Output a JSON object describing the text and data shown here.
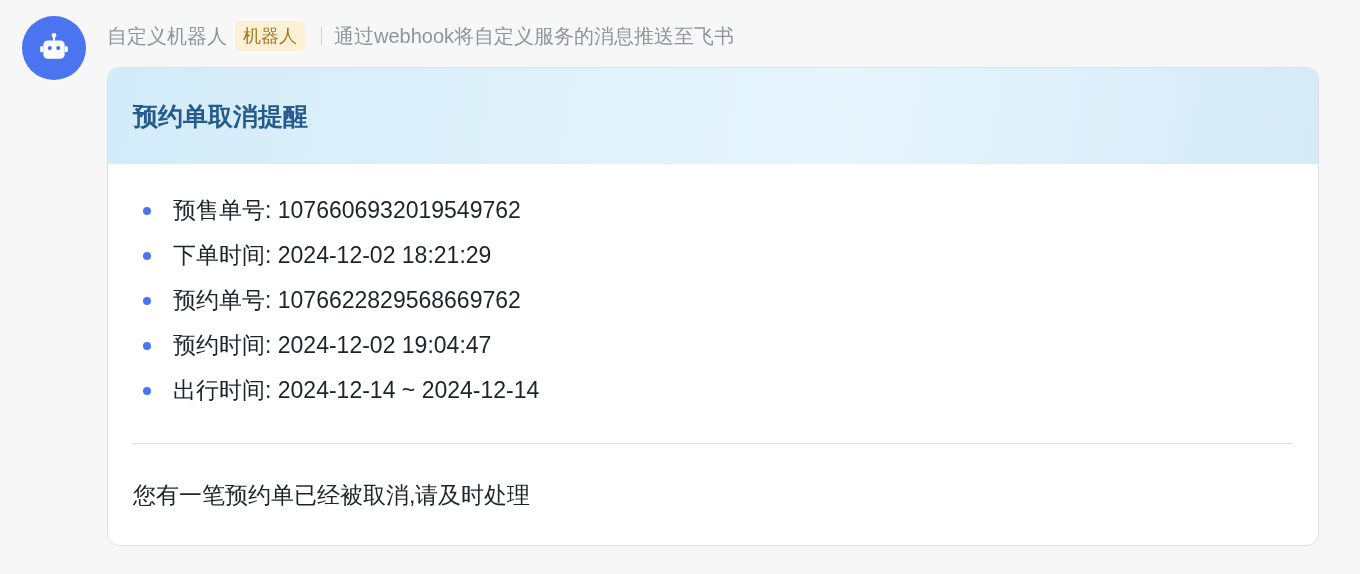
{
  "sender": {
    "name": "自定义机器人",
    "badge": "机器人",
    "description": "通过webhook将自定义服务的消息推送至飞书"
  },
  "card": {
    "title": "预约单取消提醒",
    "items": [
      {
        "text": "预售单号: 1076606932019549762"
      },
      {
        "text": "下单时间: 2024-12-02 18:21:29"
      },
      {
        "text": "预约单号: 1076622829568669762"
      },
      {
        "text": "预约时间: 2024-12-02 19:04:47"
      },
      {
        "text": "出行时间: 2024-12-14 ~ 2024-12-14"
      }
    ],
    "footer": "您有一笔预约单已经被取消,请及时处理"
  }
}
